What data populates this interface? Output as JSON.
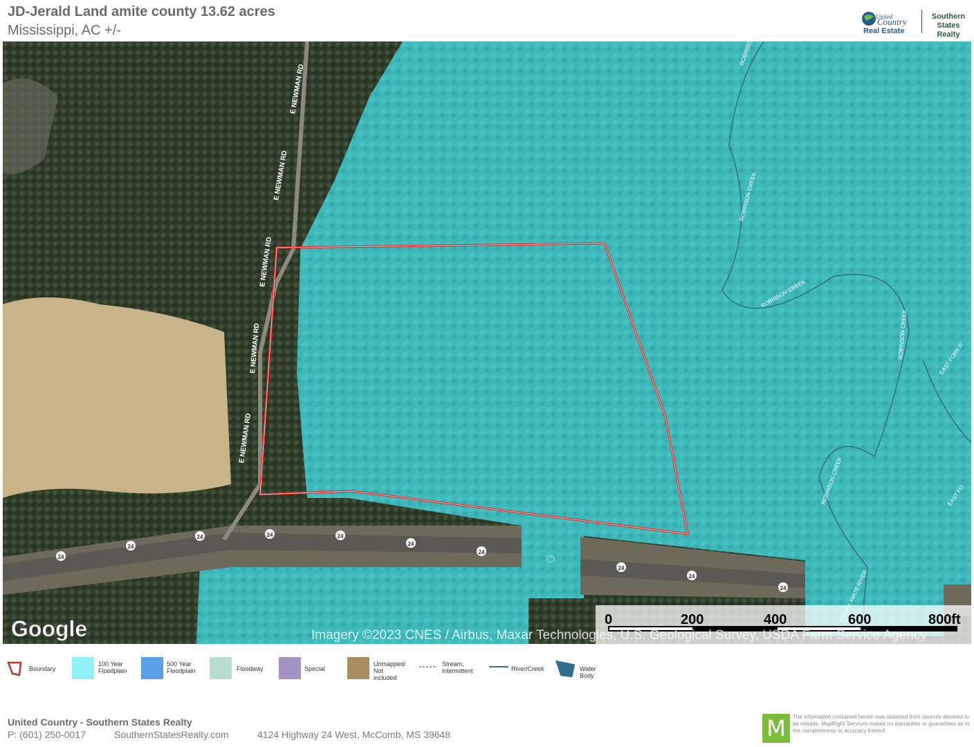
{
  "header": {
    "title": "JD-Jerald Land amite county 13.62 acres",
    "subtitle": "Mississippi,  AC +/-",
    "logo_line1": "United",
    "logo_line2": "Country",
    "logo_line3": "Real Estate",
    "logo_brand": "Southern\nStates Realty"
  },
  "map": {
    "roads": {
      "newman": "E NEWMAN RD",
      "highway": "24"
    },
    "creeks": {
      "robinson": "ROBINSON CREEK",
      "robinson_short": "ROBINSON",
      "east_fork": "EAST FORK R",
      "east_fork2": "EAST FO",
      "amite": "T FORK AMITE RIVER"
    },
    "google": "Google",
    "attribution": "Imagery ©2023 CNES / Airbus, Maxar Technologies, U.S. Geological Survey, USDA Farm Service Agency",
    "scale": {
      "labels": [
        "0",
        "200",
        "400",
        "600",
        "800ft"
      ]
    },
    "colors": {
      "floodplain": "#3fc6c8",
      "boundary": "#e02020"
    }
  },
  "legend": [
    {
      "label": "Boundary",
      "icon": "boundary-icon"
    },
    {
      "label": "100 Year\nFloodplain",
      "color": "#8ff0f5"
    },
    {
      "label": "500 Year\nFloodplain",
      "color": "#5aa0e8"
    },
    {
      "label": "Floodway",
      "color": "#b8dcd0"
    },
    {
      "label": "Special",
      "color": "#a393c4"
    },
    {
      "label": "Unmapped/\nNot included",
      "color": "#a88e63"
    },
    {
      "label": "Stream,\nintermittent",
      "icon": "dashed-line-icon"
    },
    {
      "label": "River/Creek",
      "icon": "line-icon"
    },
    {
      "label": "Water Body",
      "color": "#2f6f8a"
    }
  ],
  "footer": {
    "company": "United Country - Southern States Realty",
    "phone": "P: (601) 250-0017",
    "website": "SouthernStatesRealty.com",
    "address": "4124 Highway 24 West, McComb, MS 39648",
    "mlogo": "M",
    "disclaimer": "The information contained herein was obtained from sources deemed to be reliable. MapRight Services makes no warranties or guarantees as to the completeness or accuracy thereof."
  }
}
